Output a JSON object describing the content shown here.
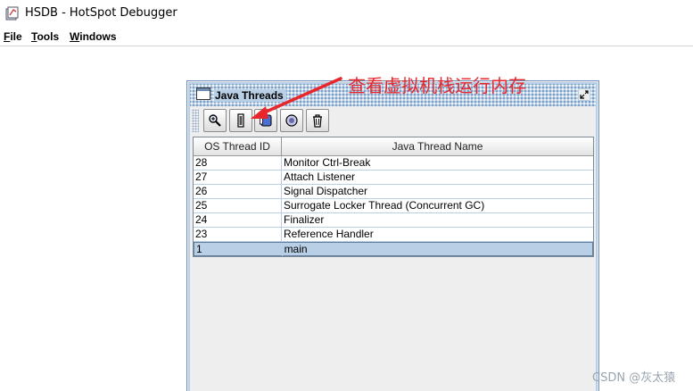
{
  "window": {
    "title": "HSDB - HotSpot Debugger"
  },
  "menubar": {
    "items": [
      {
        "mnemonic": "F",
        "rest": "ile"
      },
      {
        "mnemonic": "T",
        "rest": "ools"
      },
      {
        "mnemonic": "W",
        "rest": "indows"
      }
    ]
  },
  "frame": {
    "title": "Java Threads",
    "toolbar": {
      "buttons": [
        {
          "name": "inspect-thread",
          "icon": "magnifier-icon"
        },
        {
          "name": "stack-memory",
          "icon": "stack-memory-icon"
        },
        {
          "name": "java-stack-trace",
          "icon": "stack-trace-icon"
        },
        {
          "name": "thread-info",
          "icon": "info-icon"
        },
        {
          "name": "find-crashes",
          "icon": "trash-icon"
        }
      ]
    },
    "table": {
      "columns": [
        "OS Thread ID",
        "Java Thread Name"
      ],
      "rows": [
        {
          "id": "28",
          "name": "Monitor Ctrl-Break"
        },
        {
          "id": "27",
          "name": "Attach Listener"
        },
        {
          "id": "26",
          "name": "Signal Dispatcher"
        },
        {
          "id": "25",
          "name": "Surrogate Locker Thread (Concurrent GC)"
        },
        {
          "id": "24",
          "name": "Finalizer"
        },
        {
          "id": "23",
          "name": "Reference Handler"
        },
        {
          "id": "1",
          "name": "main"
        }
      ],
      "selected_row": "1"
    }
  },
  "annotation": {
    "text": "查看虚拟机栈运行内存",
    "color": "#e8262b"
  },
  "watermark": {
    "text": "CSDN @灰太猿"
  },
  "colors": {
    "frame_border": "#6d8fb8",
    "selection": "#b8cfe5",
    "annotation_red": "#e8262b"
  }
}
